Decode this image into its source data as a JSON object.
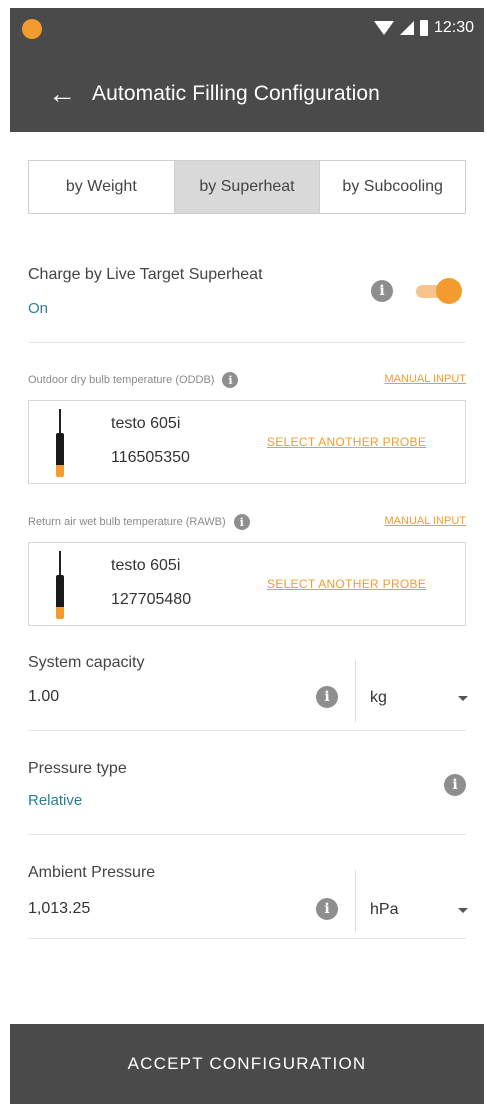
{
  "status_bar": {
    "time": "12:30"
  },
  "header": {
    "title": "Automatic Filling Configuration",
    "back_icon": "arrow-left-icon"
  },
  "tabs": [
    {
      "label": "by Weight",
      "active": false
    },
    {
      "label": "by Superheat",
      "active": true
    },
    {
      "label": "by Subcooling",
      "active": false
    }
  ],
  "live_target": {
    "label": "Charge by Live Target Superheat",
    "value": "On",
    "toggle_on": true
  },
  "probes": [
    {
      "label": "Outdoor dry bulb temperature (ODDB)",
      "manual_input": "MANUAL INPUT",
      "name": "testo 605i",
      "serial": "116505350",
      "select_label": "SELECT ANOTHER PROBE"
    },
    {
      "label": "Return air wet bulb temperature (RAWB)",
      "manual_input": "MANUAL INPUT",
      "name": "testo 605i",
      "serial": "127705480",
      "select_label": "SELECT ANOTHER PROBE"
    }
  ],
  "system_capacity": {
    "label": "System capacity",
    "value": "1.00",
    "unit": "kg"
  },
  "pressure_type": {
    "label": "Pressure type",
    "value": "Relative"
  },
  "ambient_pressure": {
    "label": "Ambient Pressure",
    "value": "1,013.25",
    "unit": "hPa"
  },
  "footer": {
    "accept_label": "ACCEPT CONFIGURATION"
  },
  "colors": {
    "accent": "#f39b2e",
    "header_bg": "#4a4a4a",
    "link_blue": "#2a7f95"
  }
}
